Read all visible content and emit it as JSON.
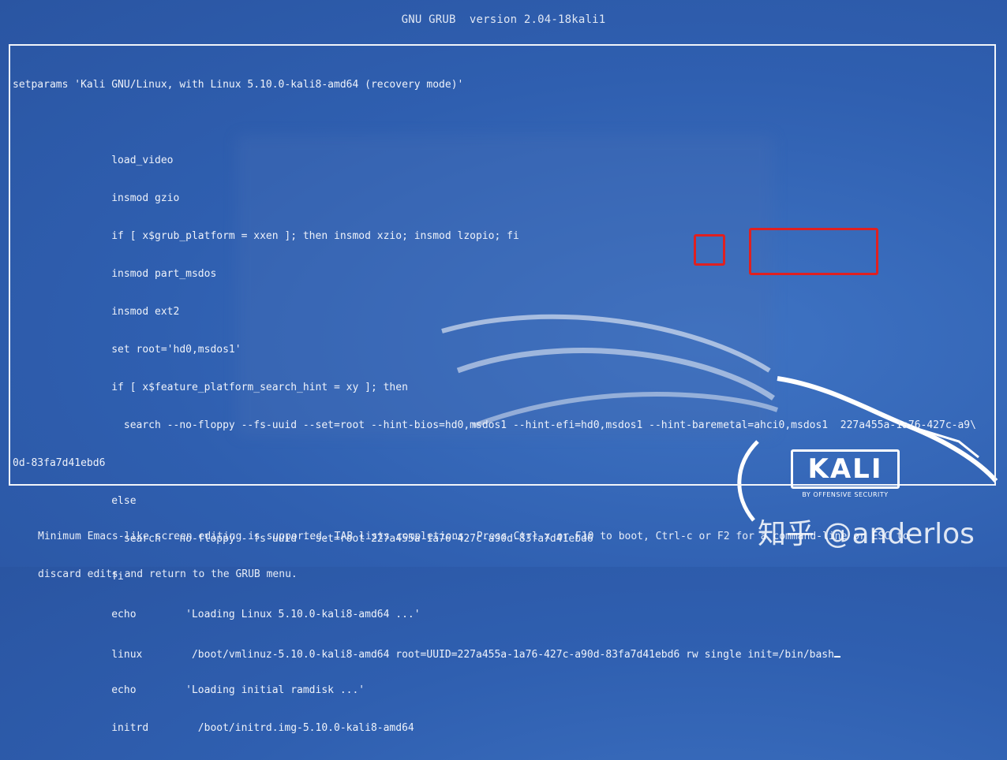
{
  "header": {
    "title": "GNU GRUB  version 2.04-18kali1"
  },
  "editor": {
    "lines": [
      "setparams 'Kali GNU/Linux, with Linux 5.10.0-kali8-amd64 (recovery mode)'",
      "",
      "                load_video",
      "                insmod gzio",
      "                if [ x$grub_platform = xxen ]; then insmod xzio; insmod lzopio; fi",
      "                insmod part_msdos",
      "                insmod ext2",
      "                set root='hd0,msdos1'",
      "                if [ x$feature_platform_search_hint = xy ]; then",
      "                  search --no-floppy --fs-uuid --set=root --hint-bios=hd0,msdos1 --hint-efi=hd0,msdos1 --hint-baremetal=ahci0,msdos1  227a455a-1a76-427c-a9\\",
      "0d-83fa7d41ebd6",
      "                else",
      "                  search --no-floppy --fs-uuid --set=root 227a455a-1a76-427c-a90d-83fa7d41ebd6",
      "                fi",
      "                echo        'Loading Linux 5.10.0-kali8-amd64 ...'",
      "                linux        /boot/vmlinuz-5.10.0-kali8-amd64 root=UUID=227a455a-1a76-427c-a90d-83fa7d41ebd6 rw single init=/bin/bash",
      "                echo        'Loading initial ramdisk ...'",
      "                initrd        /boot/initrd.img-5.10.0-kali8-amd64"
    ]
  },
  "footer": {
    "line1": "Minimum Emacs-like screen editing is supported. TAB lists completions. Press Ctrl-x or F10 to boot, Ctrl-c or F2 for a command-line or ESC to",
    "line2": "discard edits and return to the GRUB menu."
  },
  "branding": {
    "logo_text": "KALI",
    "logo_subtext": "BY OFFENSIVE SECURITY",
    "watermark": "知乎 @anderlos"
  },
  "colors": {
    "background": "#2f5fb0",
    "highlight": "#e02020",
    "text": "#eef2fa"
  }
}
